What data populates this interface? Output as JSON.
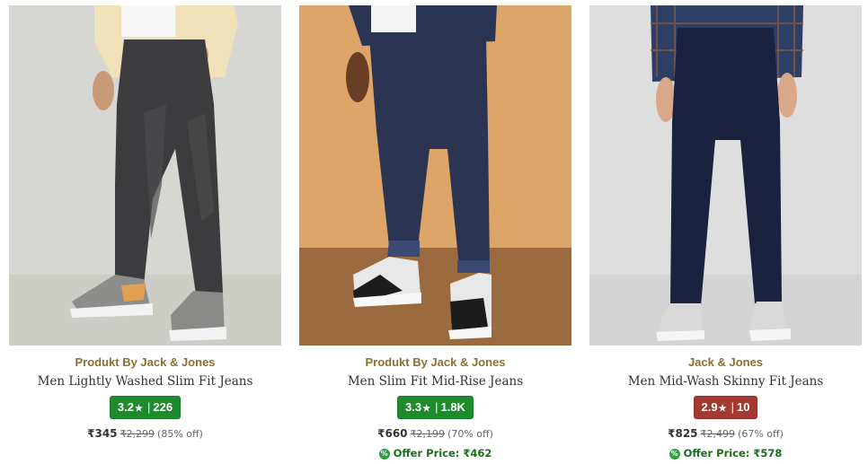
{
  "colors": {
    "rating_green": "#1e8a2e",
    "rating_red": "#a33a32",
    "brand_text": "#8b6f2e",
    "offer_green": "#1a6e1a"
  },
  "products": [
    {
      "brand": "Produkt By Jack & Jones",
      "name": "Men Lightly Washed Slim Fit Jeans",
      "rating": "3.2",
      "rating_star": "★",
      "rating_sep": "|",
      "reviews": "226",
      "rating_color": "green",
      "price": "₹345",
      "mrp": "₹2,299",
      "discount": "(85% off)",
      "offer_label": "",
      "image_icon": "jeans-photo"
    },
    {
      "brand": "Produkt By Jack & Jones",
      "name": "Men Slim Fit Mid-Rise Jeans",
      "rating": "3.3",
      "rating_star": "★",
      "rating_sep": "|",
      "reviews": "1.8K",
      "rating_color": "green",
      "price": "₹660",
      "mrp": "₹2,199",
      "discount": "(70% off)",
      "offer_label": "Offer Price: ₹462",
      "image_icon": "jeans-photo"
    },
    {
      "brand": "Jack & Jones",
      "name": "Men Mid-Wash Skinny Fit Jeans",
      "rating": "2.9",
      "rating_star": "★",
      "rating_sep": "|",
      "reviews": "10",
      "rating_color": "red",
      "price": "₹825",
      "mrp": "₹2,499",
      "discount": "(67% off)",
      "offer_label": "Offer Price: ₹578",
      "image_icon": "jeans-photo"
    }
  ]
}
